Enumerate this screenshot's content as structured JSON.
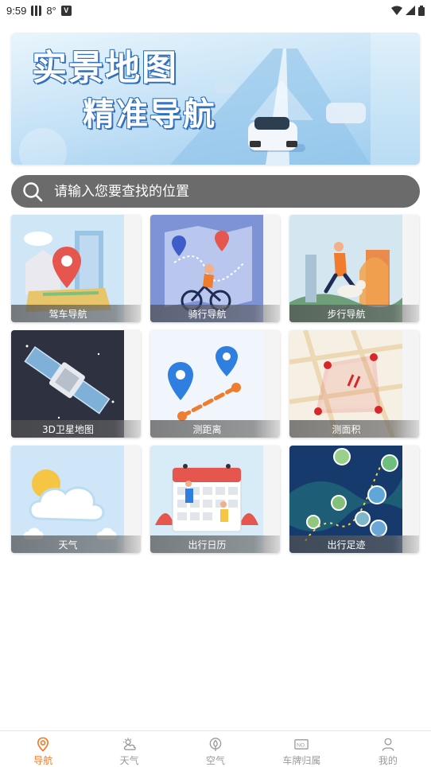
{
  "status_bar": {
    "time": "9:59",
    "temperature": "8°",
    "icons": [
      "wifi-icon",
      "signal-icon",
      "battery-icon"
    ]
  },
  "banner": {
    "title": "实景地图",
    "subtitle": "精准导航"
  },
  "search": {
    "placeholder": "请输入您要查找的位置"
  },
  "features": [
    {
      "label": "驾车导航",
      "icon": "car-navigation-illustration"
    },
    {
      "label": "骑行导航",
      "icon": "cycling-navigation-illustration"
    },
    {
      "label": "步行导航",
      "icon": "walking-navigation-illustration"
    },
    {
      "label": "3D卫星地图",
      "icon": "satellite-map-illustration"
    },
    {
      "label": "测距离",
      "icon": "measure-distance-illustration"
    },
    {
      "label": "测面积",
      "icon": "measure-area-illustration"
    },
    {
      "label": "天气",
      "icon": "weather-illustration"
    },
    {
      "label": "出行日历",
      "icon": "travel-calendar-illustration"
    },
    {
      "label": "出行足迹",
      "icon": "travel-footprint-illustration"
    }
  ],
  "bottom_nav": [
    {
      "label": "导航",
      "icon": "location-pin-icon",
      "active": true
    },
    {
      "label": "天气",
      "icon": "sun-cloud-icon",
      "active": false
    },
    {
      "label": "空气",
      "icon": "leaf-icon",
      "active": false
    },
    {
      "label": "车牌归属",
      "icon": "license-plate-icon",
      "active": false
    },
    {
      "label": "我的",
      "icon": "person-icon",
      "active": false
    }
  ],
  "colors": {
    "accent": "#f07c2e",
    "inactive": "#9a9a9a",
    "search_bg": "#6b6b6b"
  }
}
